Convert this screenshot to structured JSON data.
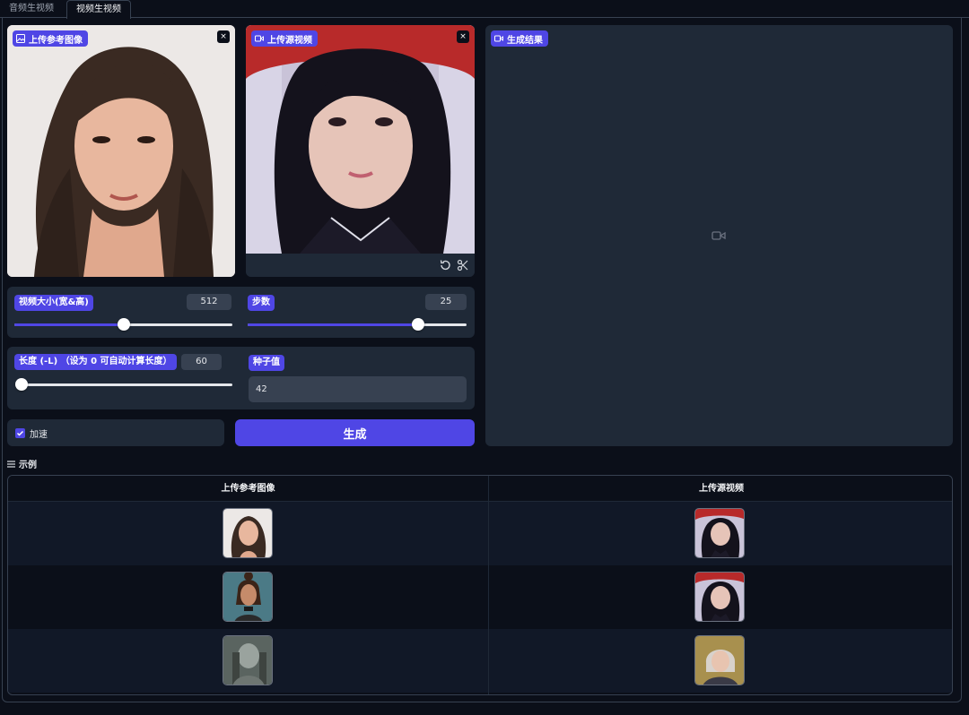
{
  "tabs": [
    {
      "label": "音频生视频",
      "active": false
    },
    {
      "label": "视频生视频",
      "active": true
    }
  ],
  "reference_image": {
    "label": "上传参考图像",
    "close": "×"
  },
  "source_video": {
    "label": "上传源视频",
    "close": "×"
  },
  "result": {
    "label": "生成结果"
  },
  "video_size": {
    "label": "视频大小(宽&高)",
    "value": "512",
    "slider_fraction": 0.5
  },
  "steps": {
    "label": "步数",
    "value": "25",
    "slider_fraction": 0.78
  },
  "length": {
    "label": "长度 (-L) （设为 0 可自动计算长度）",
    "value": "60",
    "slider_fraction": 0.0
  },
  "seed": {
    "label": "种子值",
    "value": "42"
  },
  "accelerate": {
    "label": "加速",
    "checked": true
  },
  "generate_button": {
    "label": "生成"
  },
  "examples": {
    "title": "示例",
    "columns": [
      "上传参考图像",
      "上传源视频"
    ]
  },
  "colors": {
    "accent": "#4f46e5",
    "panel": "#1f2937",
    "background": "#0b0f19"
  }
}
